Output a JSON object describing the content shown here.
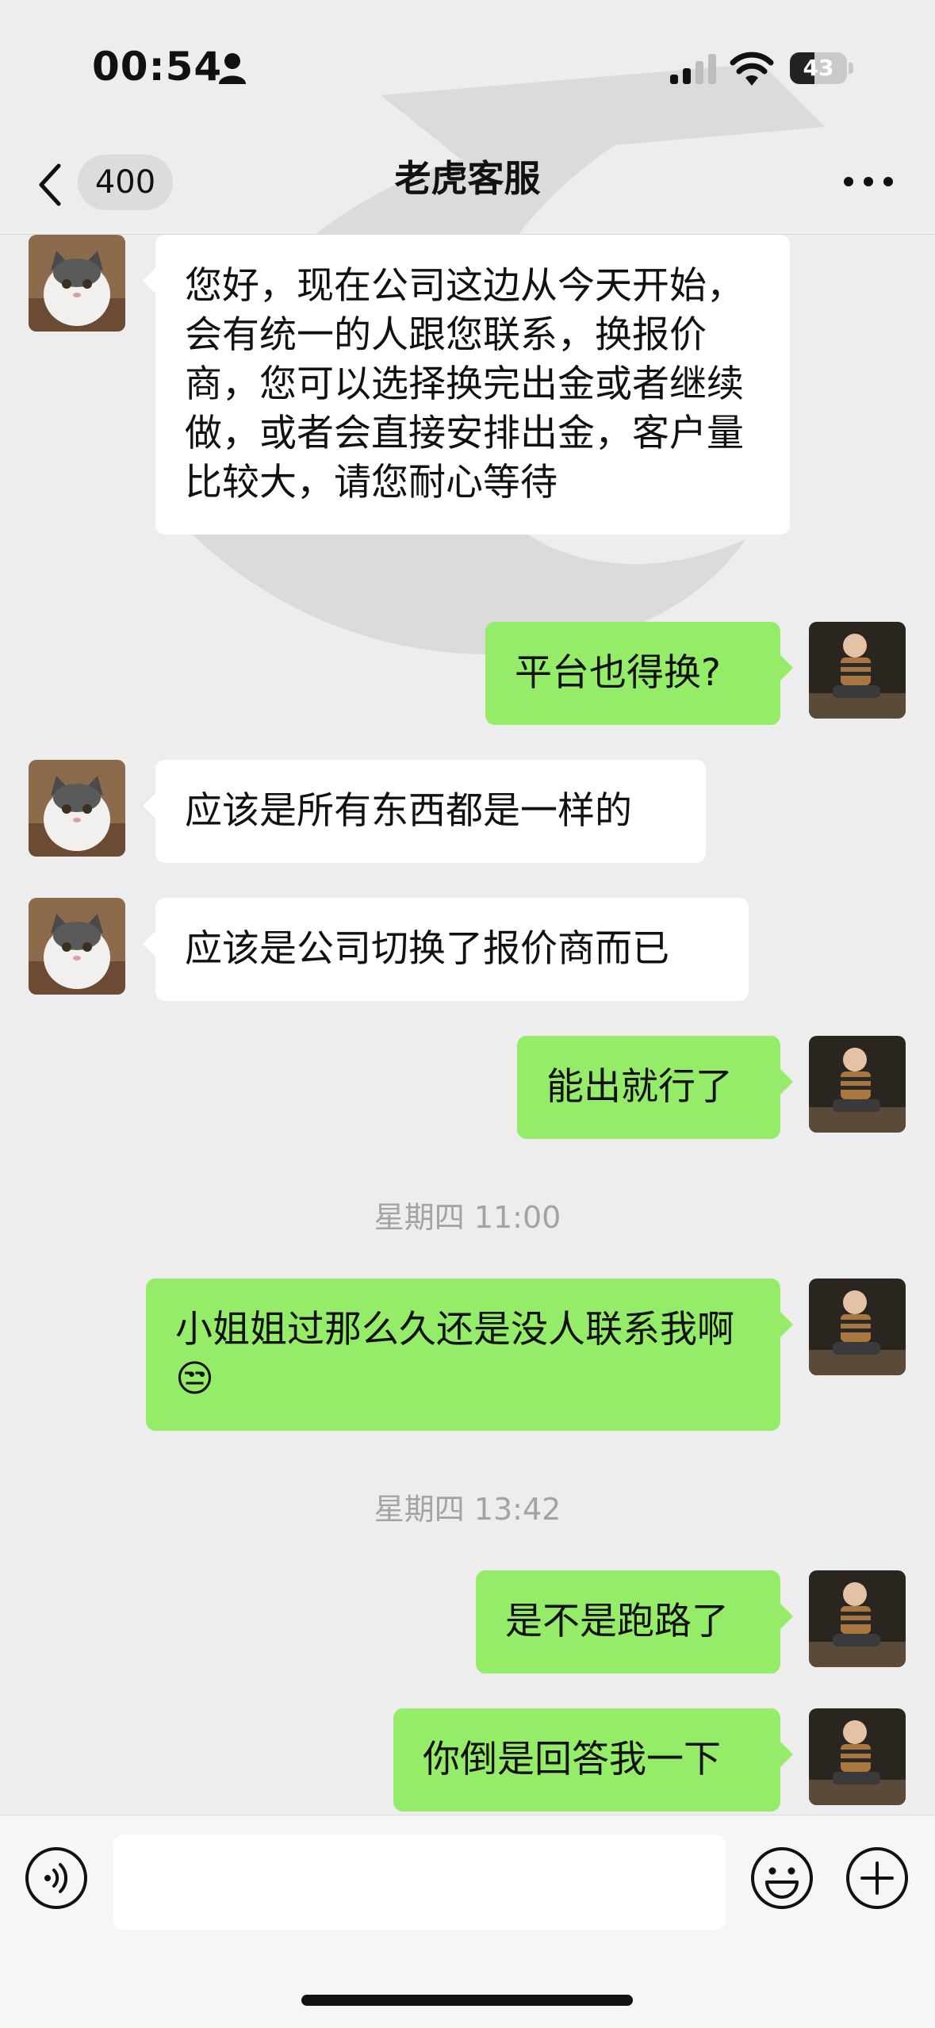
{
  "status_bar": {
    "time": "00:54",
    "battery_level": "43",
    "battery_fraction": 0.43
  },
  "nav": {
    "unread_count": "400",
    "title": "老虎客服"
  },
  "messages": [
    {
      "side": "left",
      "text": "您好，现在公司这边从今天开始，会有统一的人跟您联系，换报价商，您可以选择换完出金或者继续做，或者会直接安排出金，客户量比较大，请您耐心等待"
    },
    {
      "side": "right",
      "text": "平台也得换?"
    },
    {
      "side": "left",
      "text": "应该是所有东西都是一样的"
    },
    {
      "side": "left",
      "text": "应该是公司切换了报价商而已"
    },
    {
      "side": "right",
      "text": "能出就行了"
    },
    {
      "type": "time",
      "text": "星期四 11:00"
    },
    {
      "side": "right",
      "text": "小姐姐过那么久还是没人联系我啊😒"
    },
    {
      "type": "time",
      "text": "星期四 13:42"
    },
    {
      "side": "right",
      "text": "是不是跑路了"
    },
    {
      "side": "right",
      "text": "你倒是回答我一下"
    }
  ],
  "input": {
    "value": "",
    "placeholder": ""
  },
  "icons": {
    "back": "chevron-left-icon",
    "more": "more-dots-icon",
    "voice": "voice-icon",
    "emoji": "emoji-icon",
    "plus": "plus-icon",
    "signal": "signal-icon",
    "wifi": "wifi-icon",
    "person": "person-icon"
  },
  "colors": {
    "background": "#ededed",
    "incoming_bubble": "#ffffff",
    "outgoing_bubble": "#95ec69",
    "timestamp": "#a3a3a3"
  }
}
